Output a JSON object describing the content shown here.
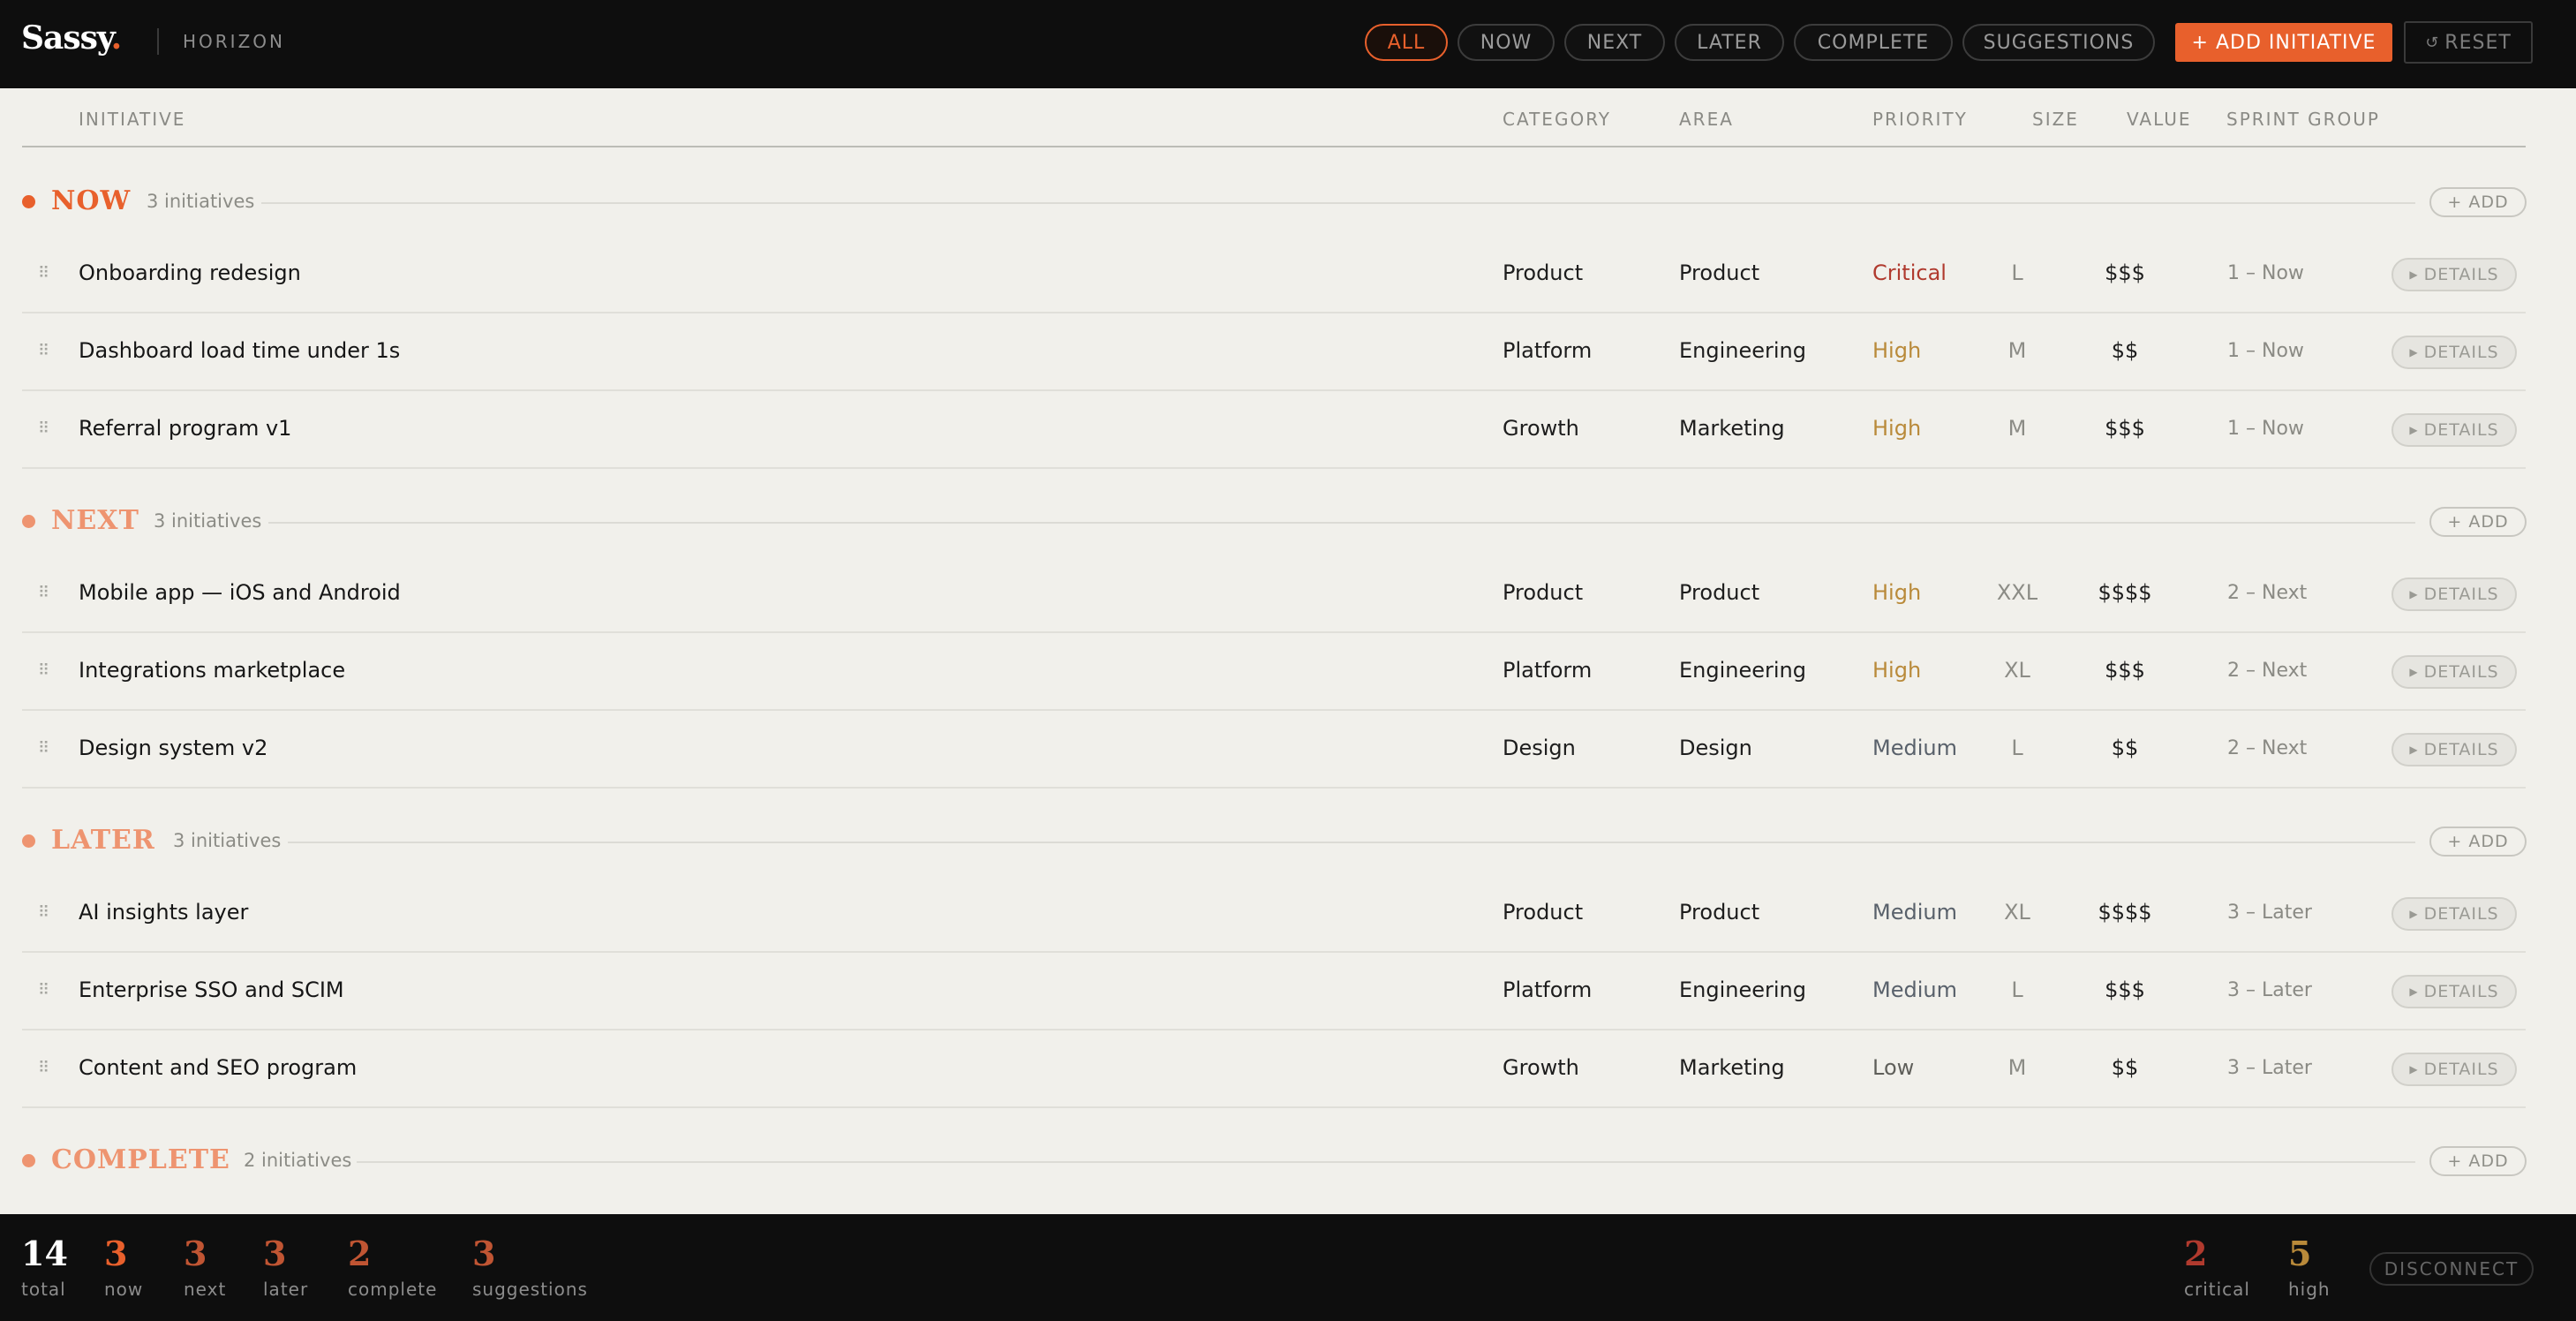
{
  "app": {
    "logo": "Sassy",
    "logo_dot": ".",
    "section": "HORIZON"
  },
  "filters": [
    {
      "label": "ALL",
      "active": true
    },
    {
      "label": "NOW",
      "active": false
    },
    {
      "label": "NEXT",
      "active": false
    },
    {
      "label": "LATER",
      "active": false
    },
    {
      "label": "COMPLETE",
      "active": false
    },
    {
      "label": "SUGGESTIONS",
      "active": false
    }
  ],
  "toolbar": {
    "add_initiative": "+ ADD INITIATIVE",
    "reset": "RESET",
    "reset_icon": "↺"
  },
  "columns": {
    "initiative": "INITIATIVE",
    "category": "CATEGORY",
    "area": "AREA",
    "priority": "PRIORITY",
    "size": "SIZE",
    "value": "VALUE",
    "sprint_group": "SPRINT GROUP"
  },
  "colors": {
    "accent": "#e8602c",
    "accent_light": "#ee9470",
    "critical": "#b03a2e",
    "high": "#b98a3a",
    "medium": "#59616b",
    "low": "#5f5f5a"
  },
  "sections": [
    {
      "title": "NOW",
      "count": "3 initiatives",
      "add": "+ ADD",
      "rows": [
        {
          "name": "Onboarding redesign",
          "category": "Product",
          "area": "Product",
          "priority": "Critical",
          "size": "L",
          "value": "$$$",
          "sprint": "1 – Now",
          "details": "DETAILS"
        },
        {
          "name": "Dashboard load time under 1s",
          "category": "Platform",
          "area": "Engineering",
          "priority": "High",
          "size": "M",
          "value": "$$",
          "sprint": "1 – Now",
          "details": "DETAILS"
        },
        {
          "name": "Referral program v1",
          "category": "Growth",
          "area": "Marketing",
          "priority": "High",
          "size": "M",
          "value": "$$$",
          "sprint": "1 – Now",
          "details": "DETAILS"
        }
      ]
    },
    {
      "title": "NEXT",
      "count": "3 initiatives",
      "add": "+ ADD",
      "rows": [
        {
          "name": "Mobile app — iOS and Android",
          "category": "Product",
          "area": "Product",
          "priority": "High",
          "size": "XXL",
          "value": "$$$$",
          "sprint": "2 – Next",
          "details": "DETAILS"
        },
        {
          "name": "Integrations marketplace",
          "category": "Platform",
          "area": "Engineering",
          "priority": "High",
          "size": "XL",
          "value": "$$$",
          "sprint": "2 – Next",
          "details": "DETAILS"
        },
        {
          "name": "Design system v2",
          "category": "Design",
          "area": "Design",
          "priority": "Medium",
          "size": "L",
          "value": "$$",
          "sprint": "2 – Next",
          "details": "DETAILS"
        }
      ]
    },
    {
      "title": "LATER",
      "count": "3 initiatives",
      "add": "+ ADD",
      "rows": [
        {
          "name": "AI insights layer",
          "category": "Product",
          "area": "Product",
          "priority": "Medium",
          "size": "XL",
          "value": "$$$$",
          "sprint": "3 – Later",
          "details": "DETAILS"
        },
        {
          "name": "Enterprise SSO and SCIM",
          "category": "Platform",
          "area": "Engineering",
          "priority": "Medium",
          "size": "L",
          "value": "$$$",
          "sprint": "3 – Later",
          "details": "DETAILS"
        },
        {
          "name": "Content and SEO program",
          "category": "Growth",
          "area": "Marketing",
          "priority": "Low",
          "size": "M",
          "value": "$$",
          "sprint": "3 – Later",
          "details": "DETAILS"
        }
      ]
    },
    {
      "title": "COMPLETE",
      "count": "2 initiatives",
      "add": "+ ADD",
      "rows": []
    }
  ],
  "stats": [
    {
      "num": "14",
      "label": "total"
    },
    {
      "num": "3",
      "label": "now"
    },
    {
      "num": "3",
      "label": "next"
    },
    {
      "num": "3",
      "label": "later"
    },
    {
      "num": "2",
      "label": "complete"
    },
    {
      "num": "3",
      "label": "suggestions"
    }
  ],
  "priority_stats": [
    {
      "num": "2",
      "label": "critical"
    },
    {
      "num": "5",
      "label": "high"
    }
  ],
  "disconnect": "DISCONNECT",
  "icons": {
    "drag": "drag-handle-icon",
    "details": "caret-right-icon",
    "reset": "refresh-icon"
  }
}
